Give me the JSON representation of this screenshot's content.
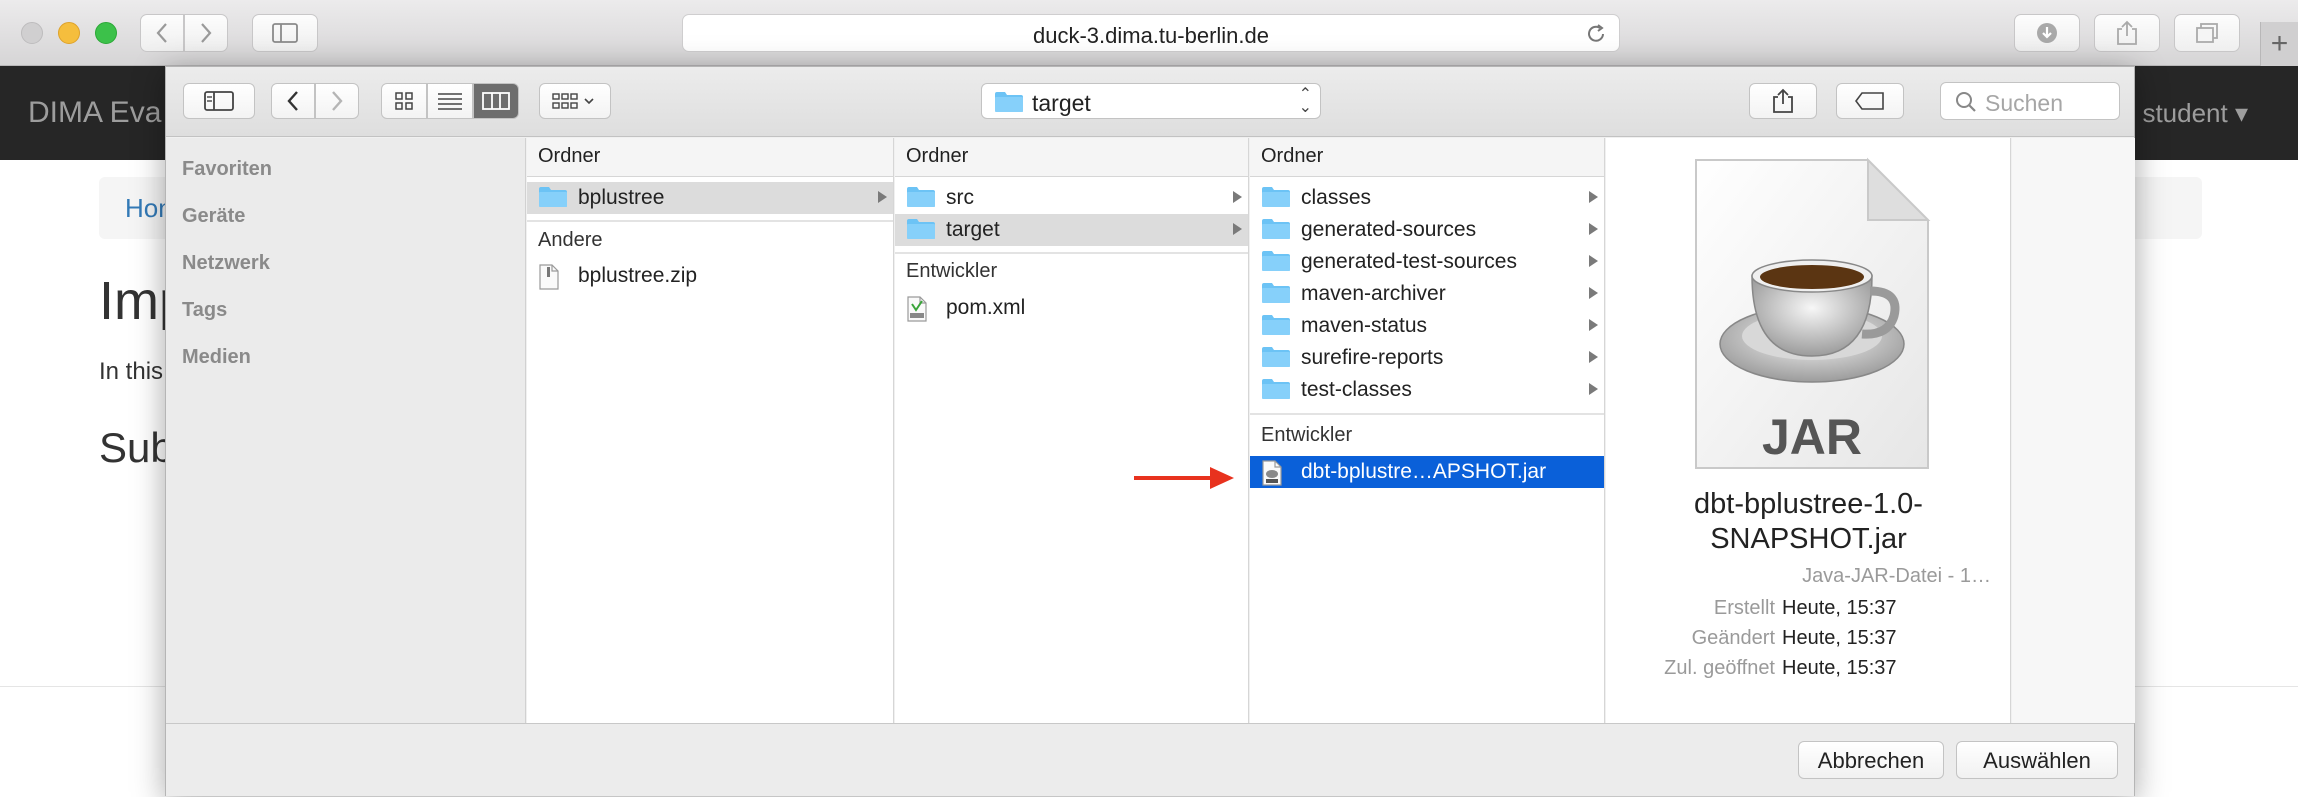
{
  "browser": {
    "url": "duck-3.dima.tu-berlin.de"
  },
  "webpage": {
    "brand": "DIMA Eva",
    "user_menu": "student ▾",
    "breadcrumb_home": "Hom",
    "heading": "Imp",
    "paragraph": "In this",
    "subheading": "Sub"
  },
  "dialog": {
    "path_popup": "target",
    "search_placeholder": "Suchen",
    "sidebar": [
      "Favoriten",
      "Geräte",
      "Netzwerk",
      "Tags",
      "Medien"
    ],
    "columns": [
      {
        "header": "Ordner",
        "folders": [
          {
            "name": "bplustree",
            "selected": true,
            "has_children": true
          }
        ],
        "sections": [
          {
            "label": "Andere",
            "files": [
              {
                "name": "bplustree.zip",
                "icon": "zip-file-icon"
              }
            ]
          }
        ]
      },
      {
        "header": "Ordner",
        "folders": [
          {
            "name": "src",
            "selected": false,
            "has_children": true
          },
          {
            "name": "target",
            "selected": true,
            "has_children": true
          }
        ],
        "sections": [
          {
            "label": "Entwickler",
            "files": [
              {
                "name": "pom.xml",
                "icon": "xml-file-icon"
              }
            ]
          }
        ]
      },
      {
        "header": "Ordner",
        "folders": [
          {
            "name": "classes",
            "selected": false,
            "has_children": true
          },
          {
            "name": "generated-sources",
            "selected": false,
            "has_children": true
          },
          {
            "name": "generated-test-sources",
            "selected": false,
            "has_children": true
          },
          {
            "name": "maven-archiver",
            "selected": false,
            "has_children": true
          },
          {
            "name": "maven-status",
            "selected": false,
            "has_children": true
          },
          {
            "name": "surefire-reports",
            "selected": false,
            "has_children": true
          },
          {
            "name": "test-classes",
            "selected": false,
            "has_children": true
          }
        ],
        "sections": [
          {
            "label": "Entwickler",
            "files": [
              {
                "name": "dbt-bplustre…APSHOT.jar",
                "icon": "jar-file-icon",
                "selected": true
              }
            ]
          }
        ]
      }
    ],
    "preview": {
      "icon_label": "JAR",
      "name_line1": "dbt-bplustree-1.0-",
      "name_line2": "SNAPSHOT.jar",
      "kind": "Java-JAR-Datei - 1…",
      "meta": [
        {
          "key": "Erstellt",
          "value": "Heute, 15:37"
        },
        {
          "key": "Geändert",
          "value": "Heute, 15:37"
        },
        {
          "key": "Zul. geöffnet",
          "value": "Heute, 15:37"
        }
      ]
    },
    "buttons": {
      "cancel": "Abbrechen",
      "choose": "Auswählen"
    }
  },
  "colors": {
    "selection_blue": "#0a60d9",
    "folder_blue": "#6cc3f5",
    "annotation_red": "#e8321e"
  }
}
